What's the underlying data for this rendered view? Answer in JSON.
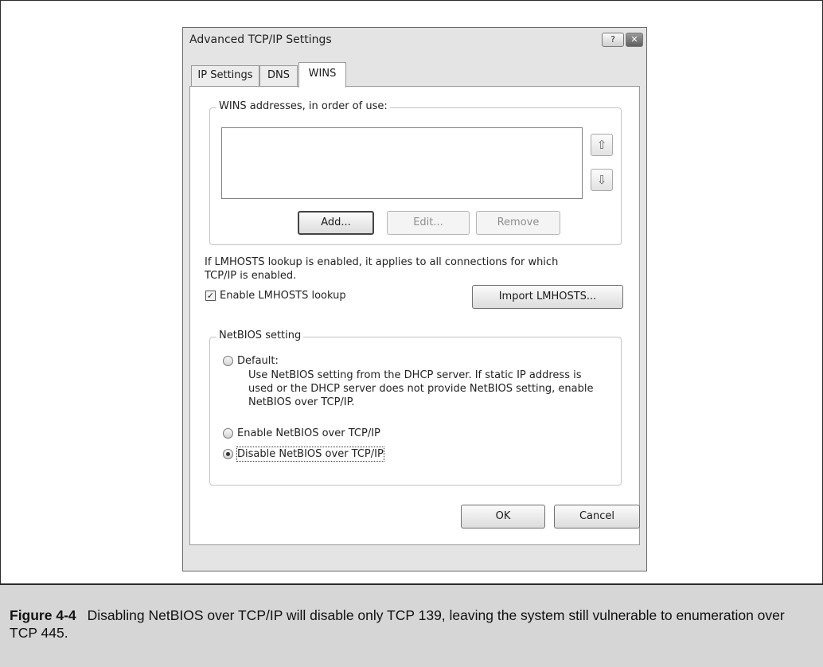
{
  "dialog": {
    "title": "Advanced TCP/IP Settings",
    "help_label": "?",
    "close_label": "✕"
  },
  "tabs": [
    {
      "label": "IP Settings"
    },
    {
      "label": "DNS"
    },
    {
      "label": "WINS",
      "active": true
    }
  ],
  "wins": {
    "group_label": "WINS addresses, in order of use:",
    "addresses": [],
    "up_arrow": "⇧",
    "down_arrow": "⇩",
    "add_label": "Add...",
    "edit_label": "Edit...",
    "remove_label": "Remove"
  },
  "lmhosts": {
    "info": "If LMHOSTS lookup is enabled, it applies to all connections for which TCP/IP is enabled.",
    "enable_label": "Enable LMHOSTS lookup",
    "enable_checked": true,
    "check_mark": "✓",
    "import_label": "Import LMHOSTS..."
  },
  "netbios": {
    "group_label": "NetBIOS setting",
    "options": [
      {
        "label": "Default:",
        "description": "Use NetBIOS setting from the DHCP server. If static IP address is used or the DHCP server does not provide NetBIOS setting, enable NetBIOS over TCP/IP.",
        "checked": false
      },
      {
        "label": "Enable NetBIOS over TCP/IP",
        "checked": false
      },
      {
        "label": "Disable NetBIOS over TCP/IP",
        "checked": true
      }
    ]
  },
  "footer": {
    "ok_label": "OK",
    "cancel_label": "Cancel"
  },
  "figure": {
    "number": "Figure 4-4",
    "caption": "Disabling NetBIOS over TCP/IP will disable only TCP 139, leaving the system still vulnerable to enumeration over TCP 445."
  }
}
